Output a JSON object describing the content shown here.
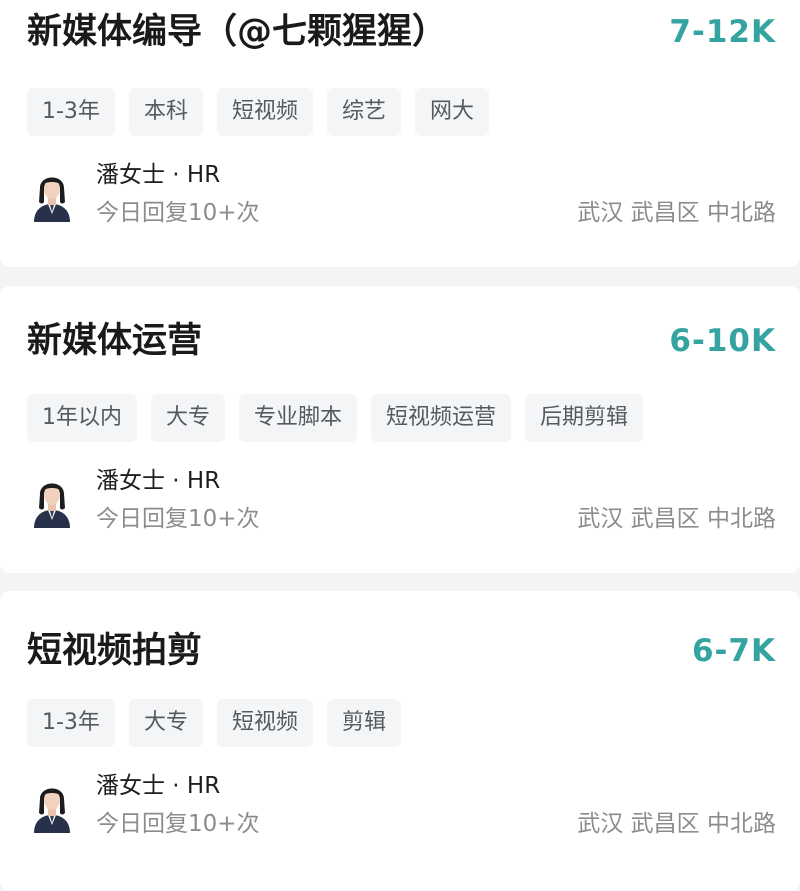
{
  "jobs": [
    {
      "title": "新媒体编导（@七颗猩猩）",
      "salary": "7-12K",
      "tags": [
        "1-3年",
        "本科",
        "短视频",
        "综艺",
        "网大"
      ],
      "hr_name": "潘女士 · HR",
      "reply": "今日回复10+次",
      "location": "武汉 武昌区 中北路"
    },
    {
      "title": "新媒体运营",
      "salary": "6-10K",
      "tags": [
        "1年以内",
        "大专",
        "专业脚本",
        "短视频运营",
        "后期剪辑"
      ],
      "hr_name": "潘女士 · HR",
      "reply": "今日回复10+次",
      "location": "武汉 武昌区 中北路"
    },
    {
      "title": "短视频拍剪",
      "salary": "6-7K",
      "tags": [
        "1-3年",
        "大专",
        "短视频",
        "剪辑"
      ],
      "hr_name": "潘女士 · HR",
      "reply": "今日回复10+次",
      "location": "武汉 武昌区 中北路"
    }
  ],
  "colors": {
    "salary": "#35a4a0",
    "title": "#1a1a1a",
    "tag_bg": "#f4f5f6",
    "tag_text": "#555a5e",
    "secondary_text": "#8a8d90",
    "page_bg": "#f3f4f5",
    "card_bg": "#ffffff"
  },
  "icons": {
    "avatar": "hr-avatar-icon"
  }
}
